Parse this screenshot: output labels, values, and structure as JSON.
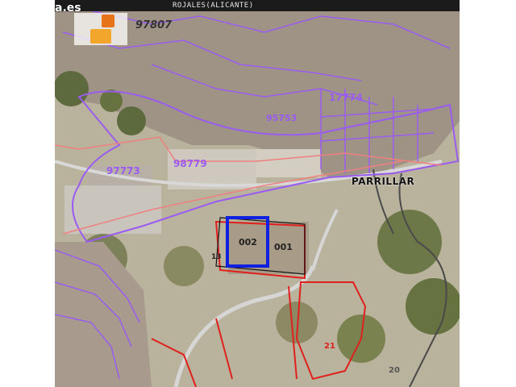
{
  "header": {
    "title": "ROJALES(ALICANTE)"
  },
  "watermark": {
    "domain_fragment": "a.es"
  },
  "map": {
    "cadastral_labels": [
      "97807",
      "98779",
      "97773",
      "17774",
      "95753",
      "21",
      "20"
    ],
    "parcel_labels": [
      "002",
      "001"
    ],
    "small_labels": [
      "13"
    ],
    "street_label": "PARRILLAR",
    "colors": {
      "vegetation": "#6f7a4c",
      "terrain": "#bfb8a4",
      "urban_blocks": "#b8a79a",
      "cadastral_purple": "#9a5cf0",
      "parcel_red": "#e0201c",
      "selected_blue": "#1020e0",
      "outline_salmon": "#f08080",
      "road_white": "#d8d8d8",
      "title_bar": "#1b1b1b"
    }
  }
}
